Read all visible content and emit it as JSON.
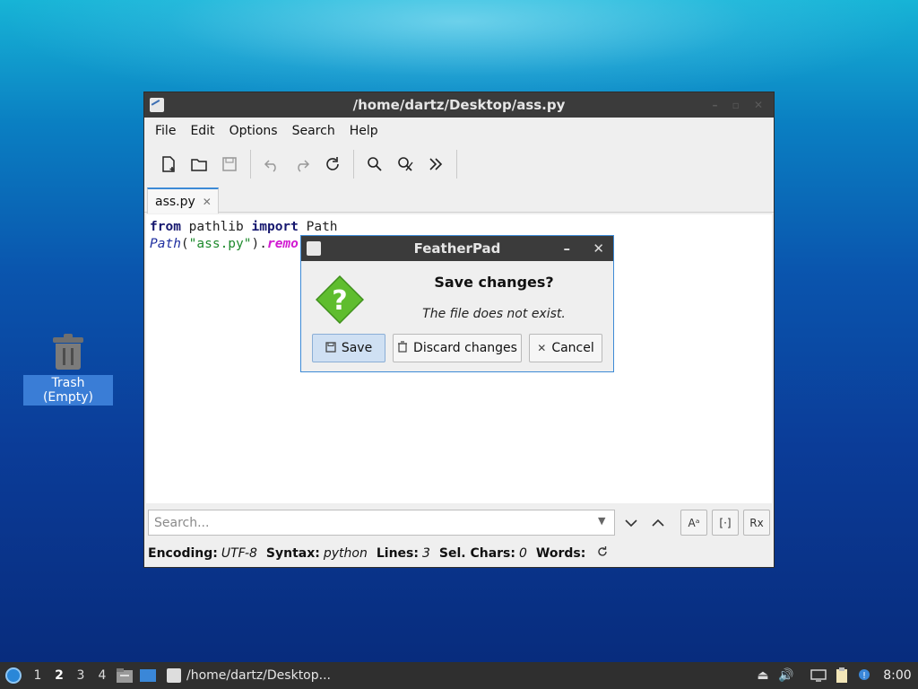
{
  "desktop": {
    "trash_label": "Trash (Empty)"
  },
  "window": {
    "title": "/home/dartz/Desktop/ass.py",
    "menus": [
      "File",
      "Edit",
      "Options",
      "Search",
      "Help"
    ],
    "toolbar_icons": [
      "new-file-icon",
      "open-folder-icon",
      "save-icon",
      "undo-icon",
      "redo-icon",
      "reload-icon",
      "find-icon",
      "replace-icon",
      "more-icon"
    ],
    "tab": {
      "label": "ass.py",
      "close": "✕"
    },
    "editor": {
      "line1": {
        "kw1": "from",
        "mod": " pathlib ",
        "kw2": "import",
        "name": " Path"
      },
      "line2": {
        "func": "Path",
        "open": "(",
        "str": "\"ass.py\"",
        "close": ").",
        "meth": "remo"
      }
    },
    "search": {
      "placeholder": "Search..."
    },
    "status": {
      "encoding_label": "Encoding:",
      "encoding_value": "UTF-8",
      "syntax_label": "Syntax:",
      "syntax_value": "python",
      "lines_label": "Lines:",
      "lines_value": "3",
      "sel_label": "Sel. Chars:",
      "sel_value": "0",
      "words_label": "Words:"
    }
  },
  "dialog": {
    "title": "FeatherPad",
    "heading": "Save changes?",
    "message": "The file does not exist.",
    "buttons": {
      "save": "Save",
      "discard": "Discard changes",
      "cancel": "Cancel"
    }
  },
  "taskbar": {
    "desktops": [
      "1",
      "2",
      "3",
      "4"
    ],
    "active_desktop": "2",
    "task_title": "/home/dartz/Desktop...",
    "clock": "8:00"
  },
  "colors": {
    "accent": "#3d8ad6",
    "titlebar": "#3b3b3b",
    "keyword": "#16186f",
    "string": "#1d8a2c",
    "method": "#d11ad1"
  }
}
